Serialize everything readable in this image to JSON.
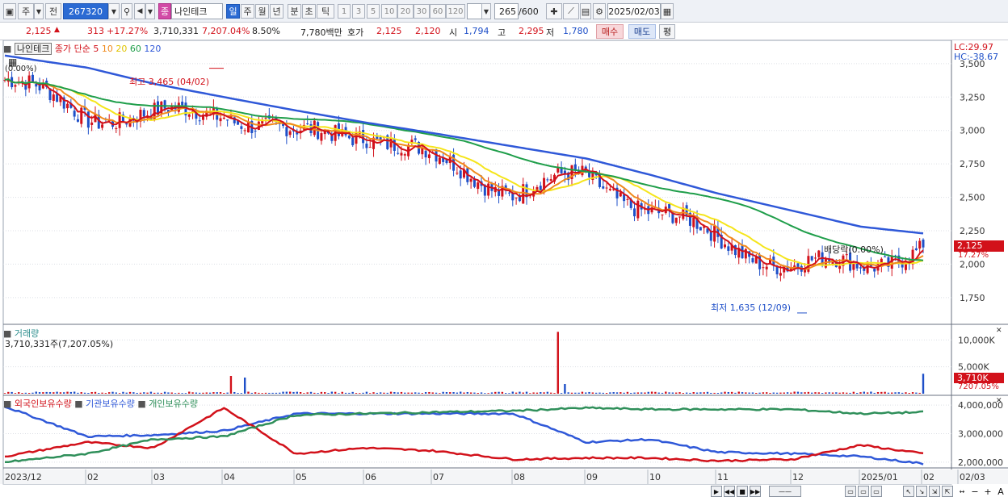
{
  "toolbar": {
    "period_prefix": "주",
    "jeon_label": "전",
    "code": "267320",
    "stock_badge": "종",
    "stock_name": "나인테크",
    "period_buttons": [
      "일",
      "주",
      "월",
      "년",
      "분",
      "초",
      "틱"
    ],
    "active_period": "일",
    "count_buttons": [
      "1",
      "3",
      "5",
      "10",
      "20",
      "30",
      "60",
      "120"
    ],
    "count_display": "265",
    "count_max": "/600",
    "date": "2025/02/03"
  },
  "quote": {
    "price": "2,125",
    "change": "313",
    "change_pct": "+17.27%",
    "volume": "3,710,331",
    "volume_pct": "7,207.04%",
    "turnover_pct": "8.50%",
    "amount": "7,780백만",
    "hoga_label": "호가",
    "hoga_ask": "2,125",
    "hoga_bid": "2,120",
    "open_label": "시",
    "open": "1,794",
    "high_label": "고",
    "high": "2,295",
    "low_label": "저",
    "low": "1,780",
    "buy_label": "매수",
    "sell_label": "매도",
    "eval_label": "평"
  },
  "price_panel": {
    "title": "나인테크",
    "ma_label": "종가 단순",
    "ma_periods": [
      "5",
      "10",
      "20",
      "60",
      "120"
    ],
    "pct_label": "(0.00%)",
    "lc_label": "LC:29.97",
    "hc_label": "HC:-38.67",
    "high_annotation": "최고 3,465 (04/02)",
    "low_annotation": "최저 1,635 (12/09)",
    "dividend_annotation": "배당락(0.00%)",
    "current_tag": "2,125",
    "current_pct": "17.27%"
  },
  "volume_panel": {
    "title": "거래량",
    "summary": "3,710,331주(7,207.05%)",
    "current_tag": "3,710K",
    "current_pct": "7207.05%"
  },
  "holdings_panel": {
    "labels": [
      "외국인보유수량",
      "기관보유수량",
      "개인보유수량"
    ]
  },
  "x_axis_labels": [
    "2023/12",
    "02",
    "03",
    "04",
    "05",
    "06",
    "07",
    "08",
    "09",
    "10",
    "11",
    "12",
    "2025/01",
    "02",
    "02/03"
  ],
  "colors": {
    "up": "#d2111a",
    "down": "#1e4fc8",
    "ma5": "#d2111a",
    "ma10": "#f08a1c",
    "ma20": "#f5e51b",
    "ma60": "#1f9e4a",
    "ma120": "#2f58d8",
    "foreign": "#2f58d8",
    "institution": "#d2111a",
    "individual": "#2f8f5a"
  },
  "chart_data": [
    {
      "type": "line",
      "title": "나인테크",
      "x": [
        "2023/12",
        "02",
        "03",
        "04",
        "05",
        "06",
        "07",
        "08",
        "09",
        "10",
        "11",
        "12",
        "2025/01",
        "02"
      ],
      "ylim": [
        1550,
        3650
      ],
      "y_ticks": [
        "3,500",
        "3,250",
        "3,000",
        "2,750",
        "2,500",
        "2,250",
        "2,000",
        "1,750"
      ],
      "series": [
        {
          "name": "종가",
          "values": [
            3380,
            3120,
            3100,
            3150,
            2950,
            3000,
            2780,
            2550,
            2650,
            2420,
            2180,
            1980,
            2000,
            2125
          ]
        },
        {
          "name": "120",
          "values": [
            3560,
            3470,
            3350,
            3250,
            3150,
            3060,
            2980,
            2880,
            2790,
            2670,
            2530,
            2400,
            2280,
            2230
          ]
        }
      ],
      "annotations": {
        "high": 3465,
        "low": 1635,
        "current": 2125
      }
    },
    {
      "type": "bar",
      "title": "거래량",
      "y_ticks": [
        "10,000K",
        "5,000K"
      ],
      "ylim": [
        0,
        12000
      ],
      "spikes_k": [
        {
          "label": "04",
          "value": 3300
        },
        {
          "label": "08",
          "value": 11500
        },
        {
          "label": "02",
          "value": 3710
        }
      ]
    },
    {
      "type": "line",
      "title": "보유수량",
      "y_ticks": [
        "4,000,000",
        "3,000,000",
        "2,000,000"
      ],
      "ylim": [
        1800000,
        4200000
      ],
      "series": [
        {
          "name": "외국인보유수량",
          "values": [
            3950000,
            2900000,
            2950000,
            3100000,
            3700000,
            3700000,
            3700000,
            3700000,
            2700000,
            2800000,
            2350000,
            2300000,
            2200000,
            1950000
          ]
        },
        {
          "name": "기관보유수량",
          "values": [
            2200000,
            2700000,
            2500000,
            3900000,
            2300000,
            2500000,
            2400000,
            2100000,
            2150000,
            2150000,
            2050000,
            2100000,
            2600000,
            2300000
          ]
        },
        {
          "name": "개인보유수량",
          "values": [
            2000000,
            2300000,
            2800000,
            2900000,
            3650000,
            3700000,
            3750000,
            3800000,
            3900000,
            3850000,
            3850000,
            3850000,
            3700000,
            3750000
          ]
        }
      ]
    }
  ]
}
